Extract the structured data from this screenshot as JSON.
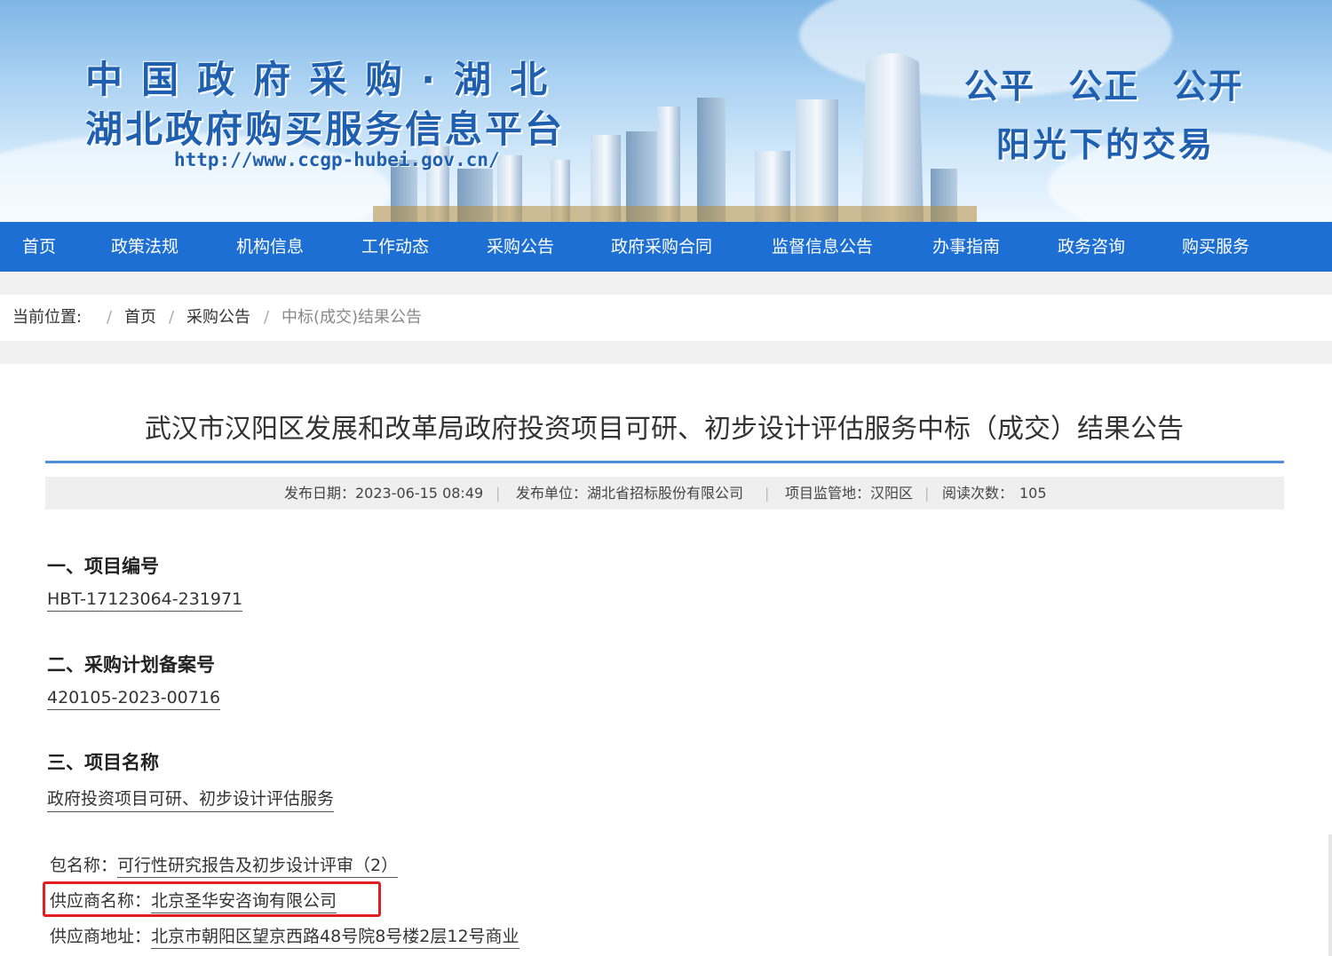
{
  "header": {
    "title_line1": "中国政府采购·湖北",
    "title_line2": "湖北政府购买服务信息平台",
    "url": "http://www.ccgp-hubei.gov.cn/",
    "slogan_line1": "公平 公正 公开",
    "slogan_line2": "阳光下的交易"
  },
  "nav": {
    "items": [
      {
        "label": "首页"
      },
      {
        "label": "政策法规"
      },
      {
        "label": "机构信息"
      },
      {
        "label": "工作动态"
      },
      {
        "label": "采购公告"
      },
      {
        "label": "政府采购合同"
      },
      {
        "label": "监督信息公告"
      },
      {
        "label": "办事指南"
      },
      {
        "label": "政务咨询"
      },
      {
        "label": "购买服务"
      }
    ]
  },
  "breadcrumb": {
    "prefix": "当前位置:",
    "sep": "/",
    "items": [
      "首页",
      "采购公告",
      "中标(成交)结果公告"
    ]
  },
  "article": {
    "title": "武汉市汉阳区发展和改革局政府投资项目可研、初步设计评估服务中标（成交）结果公告",
    "meta": {
      "publish_date": "发布日期：2023-06-15 08:49",
      "publisher": "发布单位：湖北省招标股份有限公司",
      "supervision": "项目监管地：汉阳区",
      "views_label": "阅读次数：",
      "views": "105",
      "sep": "|"
    },
    "sections": [
      {
        "heading": "一、项目编号",
        "value": "HBT-17123064-231971"
      },
      {
        "heading": "二、采购计划备案号",
        "value": "420105-2023-00716"
      },
      {
        "heading": "三、项目名称",
        "value": "政府投资项目可研、初步设计评估服务"
      }
    ],
    "details": [
      {
        "label": "包名称：",
        "value": "可行性研究报告及初步设计评审（2）"
      },
      {
        "label": "供应商名称：",
        "value": "北京圣华安咨询有限公司"
      },
      {
        "label": "供应商地址：",
        "value": "北京市朝阳区望京西路48号院8号楼2层12号商业"
      }
    ]
  },
  "colors": {
    "nav_bg": "#1e6fd3",
    "title_blue": "#1f5fb0",
    "rule_blue": "#4a8fd8",
    "highlight_red": "#e02020"
  }
}
